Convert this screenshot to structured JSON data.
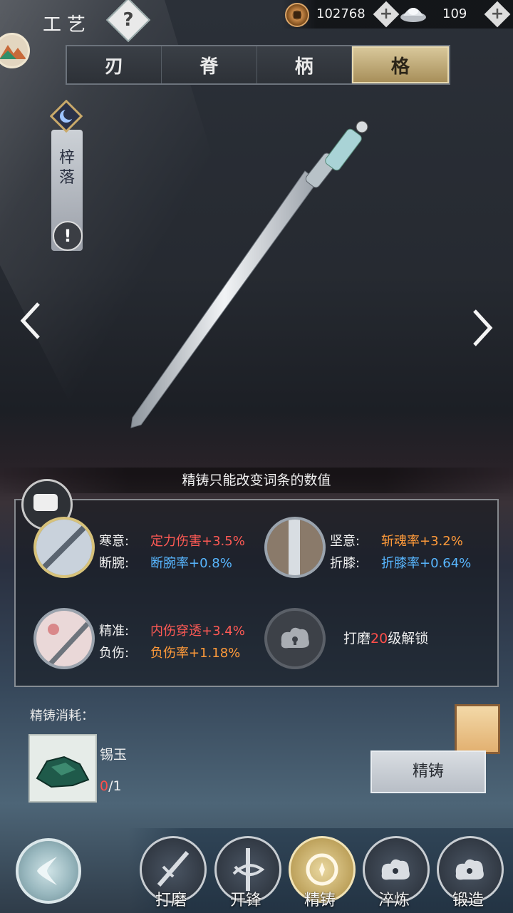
{
  "header": {
    "title": "工艺",
    "help_symbol": "?",
    "copper": "102768",
    "silver": "109",
    "plus_symbol": "+"
  },
  "tabs": [
    {
      "label": "刃",
      "active": false
    },
    {
      "label": "脊",
      "active": false
    },
    {
      "label": "柄",
      "active": false
    },
    {
      "label": "格",
      "active": true
    }
  ],
  "side_badge": {
    "text": "梓落",
    "warn_symbol": "!"
  },
  "nav_arrows": {
    "left": "‹",
    "right": "›"
  },
  "notice": "精铸只能改变词条的数值",
  "affixes": [
    {
      "line1_label": "寒意:",
      "line1_value": "定力伤害+3.5%",
      "line2_label": "断腕:",
      "line2_value": "断腕率+0.8%"
    },
    {
      "line1_label": "坚意:",
      "line1_value": "斩魂率+3.2%",
      "line2_label": "折膝:",
      "line2_value": "折膝率+0.64%"
    },
    {
      "line1_label": "精准:",
      "line1_value": "内伤穿透+3.4%",
      "line2_label": "负伤:",
      "line2_value": "负伤率+1.18%"
    }
  ],
  "locked_slot": {
    "prefix": "打磨",
    "level": "20",
    "suffix": "级解锁"
  },
  "cost": {
    "title": "精铸消耗：",
    "item_name": "锡玉",
    "have": "0",
    "need": "/1"
  },
  "forge_button": "精铸",
  "bottom_nav": [
    {
      "label": "打磨",
      "icon": "sword-sparks-icon",
      "active": false
    },
    {
      "label": "开锋",
      "icon": "sword-swirl-icon",
      "active": false
    },
    {
      "label": "精铸",
      "icon": "star-ring-icon",
      "active": true
    },
    {
      "label": "淬炼",
      "icon": "lock-cloud-icon",
      "active": false
    },
    {
      "label": "锻造",
      "icon": "lock-cloud-icon",
      "active": false
    }
  ],
  "colors": {
    "accent_gold": "#d8c79a",
    "red": "#ff5a55",
    "blue": "#58b6ff",
    "orange": "#ff9a3a"
  }
}
